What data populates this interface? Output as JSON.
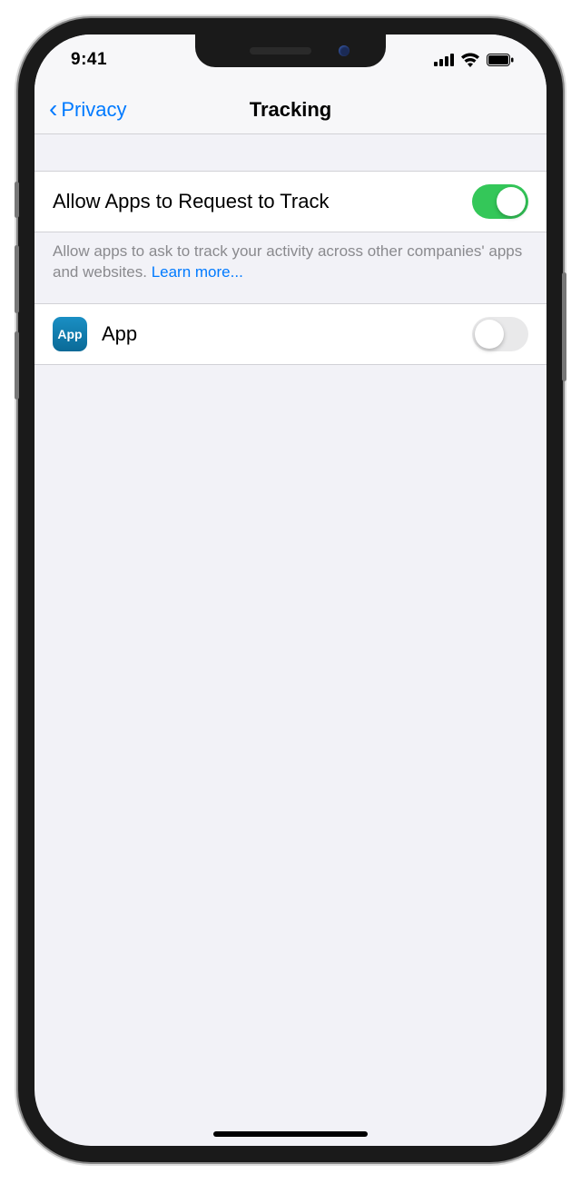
{
  "status": {
    "time": "9:41"
  },
  "nav": {
    "back": "Privacy",
    "title": "Tracking"
  },
  "main": {
    "allow": {
      "label": "Allow Apps to Request to Track",
      "on": true
    },
    "footer": {
      "text": "Allow apps to ask to track your activity across other companies' apps and websites. ",
      "link": "Learn more..."
    }
  },
  "apps": [
    {
      "icon_label": "App",
      "name": "App",
      "on": false
    }
  ]
}
